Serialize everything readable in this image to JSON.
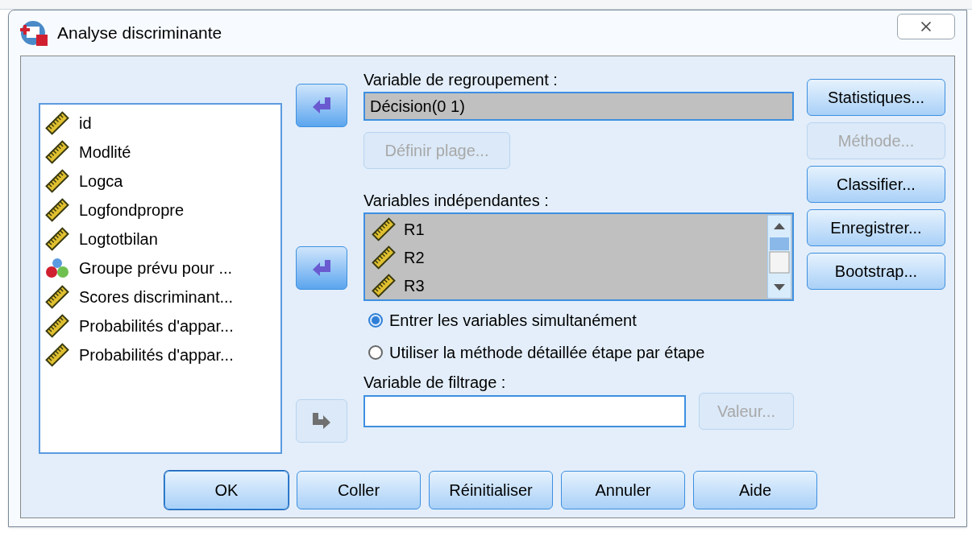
{
  "window": {
    "title": "Analyse discriminante"
  },
  "source_list": [
    {
      "name": "id",
      "kind": "scale"
    },
    {
      "name": "Modlité",
      "kind": "scale"
    },
    {
      "name": "Logca",
      "kind": "scale"
    },
    {
      "name": "Logfondpropre",
      "kind": "scale"
    },
    {
      "name": "Logtotbilan",
      "kind": "scale"
    },
    {
      "name": "Groupe prévu pour ...",
      "kind": "nominal"
    },
    {
      "name": "Scores discriminant...",
      "kind": "scale"
    },
    {
      "name": "Probabilités d'appar...",
      "kind": "scale"
    },
    {
      "name": "Probabilités d'appar...",
      "kind": "scale"
    }
  ],
  "grouping": {
    "label": "Variable de regroupement :",
    "value": "Décision(0 1)",
    "move_button": {
      "kind": "left",
      "disabled": false
    },
    "define_range_button": {
      "label": "Définir plage...",
      "disabled": true
    }
  },
  "independents": {
    "label": "Variables indépendantes :",
    "move_button": {
      "kind": "left",
      "disabled": false
    },
    "items": [
      {
        "name": "R1",
        "kind": "scale"
      },
      {
        "name": "R2",
        "kind": "scale"
      },
      {
        "name": "R3",
        "kind": "scale"
      }
    ]
  },
  "method": [
    {
      "label": "Entrer les variables simultanément",
      "selected": true
    },
    {
      "label": "Utiliser la méthode détaillée étape par étape",
      "selected": false
    }
  ],
  "filter": {
    "label": "Variable de filtrage :",
    "move_button": {
      "kind": "right",
      "disabled": true
    },
    "value_button": {
      "label": "Valeur...",
      "disabled": true
    }
  },
  "side_buttons": [
    {
      "label": "Statistiques...",
      "disabled": false
    },
    {
      "label": "Méthode...",
      "disabled": true
    },
    {
      "label": "Classifier...",
      "disabled": false
    },
    {
      "label": "Enregistrer...",
      "disabled": false
    },
    {
      "label": "Bootstrap...",
      "disabled": false
    }
  ],
  "bottom_buttons": [
    {
      "label": "OK",
      "default": true
    },
    {
      "label": "Coller",
      "default": false
    },
    {
      "label": "Réinitialiser",
      "default": false
    },
    {
      "label": "Annuler",
      "default": false
    },
    {
      "label": "Aide",
      "default": false
    }
  ]
}
